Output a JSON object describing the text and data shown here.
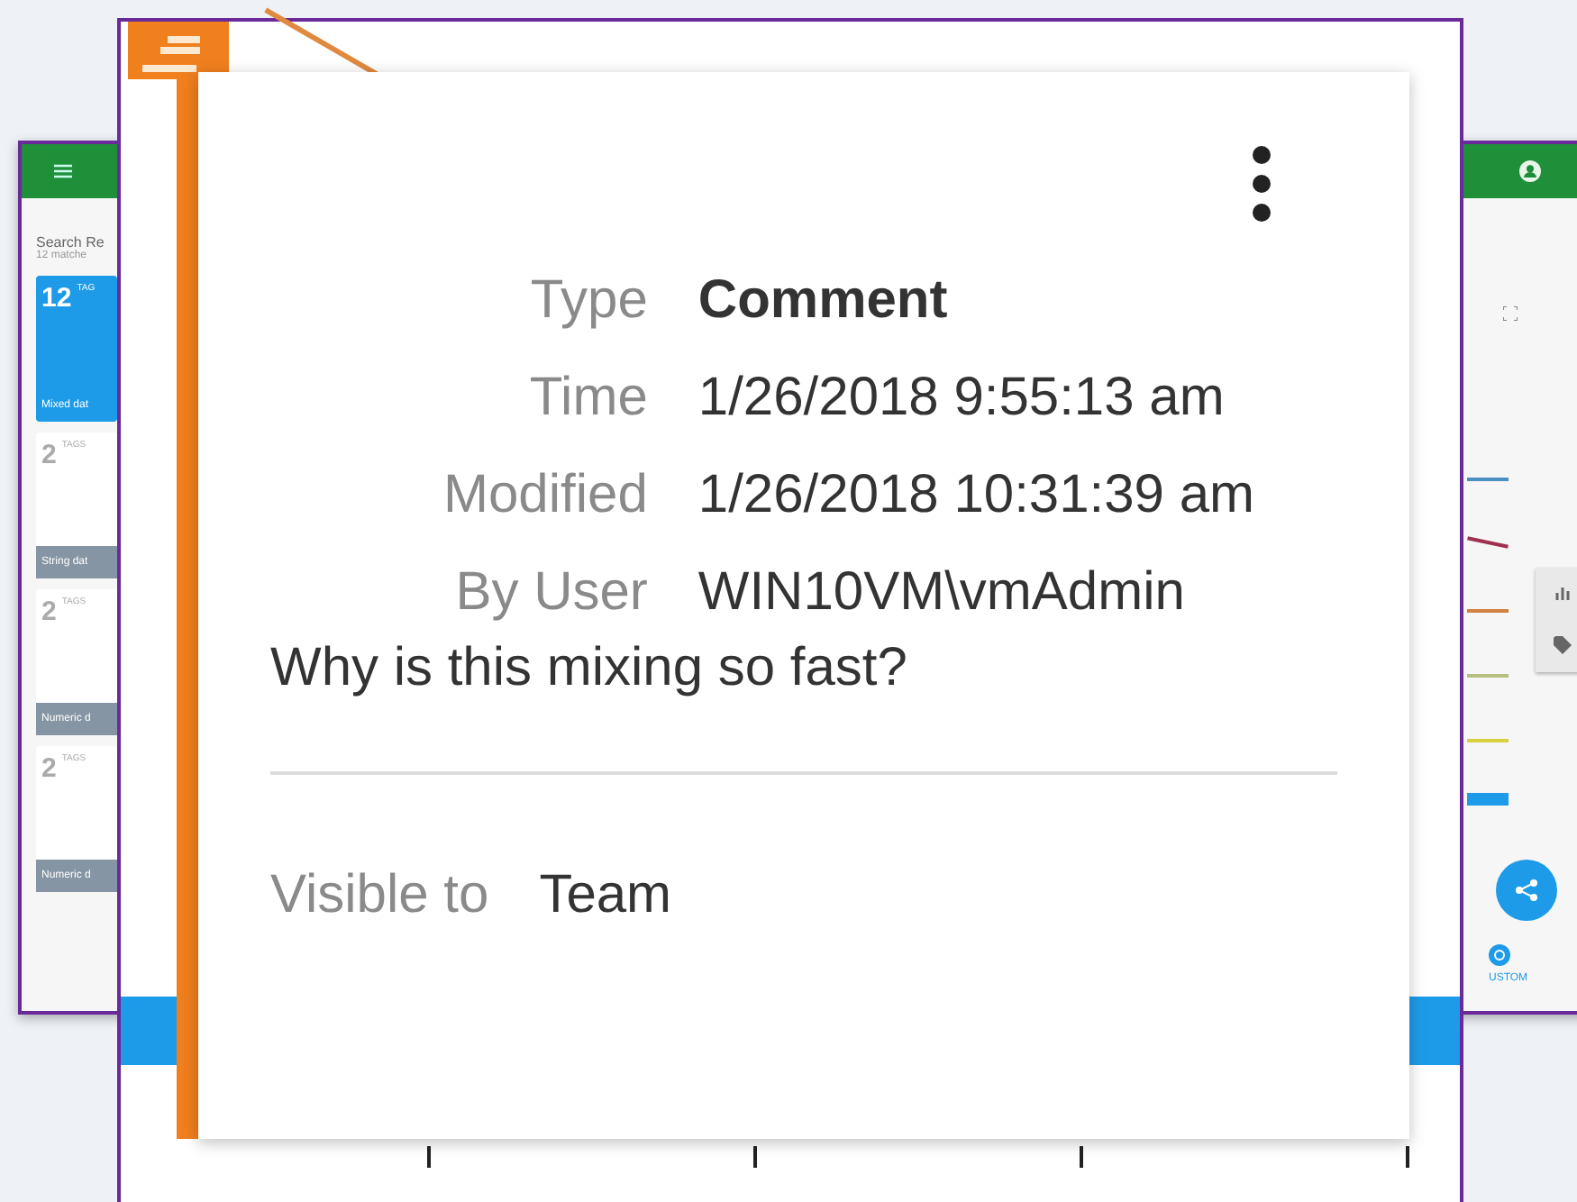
{
  "background_window": {
    "left_panel": {
      "title": "Search Re",
      "subtitle": "12 matche",
      "cards": [
        {
          "count": "12",
          "unit": "TAG",
          "label": "Mixed dat",
          "selected": true
        },
        {
          "count": "2",
          "unit": "TAGS",
          "label": "String dat",
          "selected": false
        },
        {
          "count": "2",
          "unit": "TAGS",
          "label": "Numeric d",
          "selected": false
        },
        {
          "count": "2",
          "unit": "TAGS",
          "label": "Numeric d",
          "selected": false
        }
      ]
    },
    "right_panel": {
      "custom_label": "USTOM"
    }
  },
  "comment": {
    "fields": [
      {
        "label": "Type",
        "value": "Comment",
        "kind": "title"
      },
      {
        "label": "Time",
        "value": "1/26/2018 9:55:13 am",
        "kind": "plain"
      },
      {
        "label": "Modified",
        "value": "1/26/2018 10:31:39 am",
        "kind": "plain"
      },
      {
        "label": "By User",
        "value": "WIN10VM\\vmAdmin",
        "kind": "plain"
      }
    ],
    "text": "Why is this mixing so fast?",
    "visibility": {
      "label": "Visible to",
      "value": "Team"
    }
  }
}
